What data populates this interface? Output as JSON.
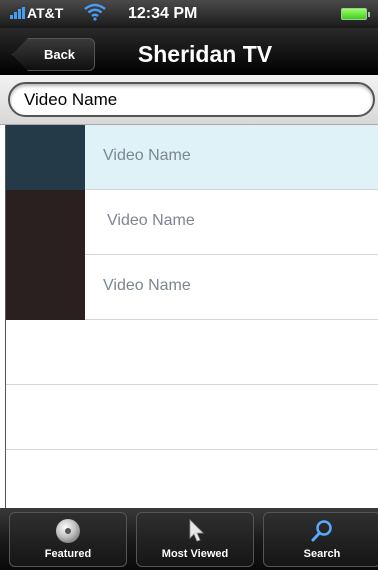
{
  "status_bar": {
    "carrier": "AT&T",
    "time": "12:34 PM"
  },
  "nav": {
    "back_label": "Back",
    "title": "Sheridan TV"
  },
  "search": {
    "value": "Video Name"
  },
  "list": {
    "rows": [
      {
        "label": "Video Name"
      },
      {
        "label": "Video Name"
      },
      {
        "label": "Video Name"
      }
    ]
  },
  "tabs": [
    {
      "label": "Featured",
      "icon": "disc-icon"
    },
    {
      "label": "Most Viewed",
      "icon": "cursor-icon"
    },
    {
      "label": "Search",
      "icon": "search-icon"
    }
  ],
  "colors": {
    "selected_row": "#dff2f8",
    "signal": "#4a9cf0",
    "battery": "#66dd33"
  }
}
